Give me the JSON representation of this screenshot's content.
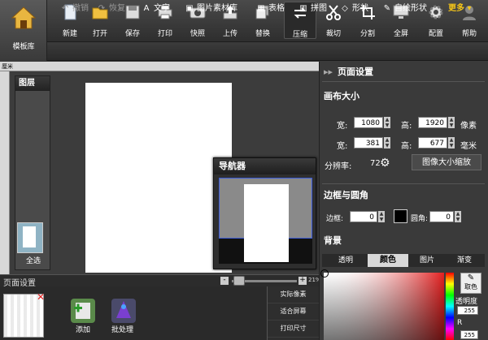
{
  "toolbar": {
    "logo_label": "模板库",
    "buttons": [
      {
        "label": "新建",
        "icon": "new-file-icon"
      },
      {
        "label": "打开",
        "icon": "folder-open-icon"
      },
      {
        "label": "保存",
        "icon": "save-disk-icon"
      },
      {
        "label": "打印",
        "icon": "printer-icon"
      },
      {
        "label": "快照",
        "icon": "camera-icon"
      },
      {
        "label": "上传",
        "icon": "upload-tray-icon"
      },
      {
        "label": "替换",
        "icon": "replace-stack-icon"
      },
      {
        "label": "压缩",
        "icon": "compress-arrows-icon"
      },
      {
        "label": "裁切",
        "icon": "scissors-icon"
      },
      {
        "label": "分割",
        "icon": "crop-icon"
      },
      {
        "label": "全屏",
        "icon": "monitor-icon"
      },
      {
        "label": "配置",
        "icon": "gear-icon"
      },
      {
        "label": "帮助",
        "icon": "help-person-icon"
      }
    ]
  },
  "toolbar2": {
    "undo": "撤销",
    "redo": "恢复",
    "text": "文字",
    "image_lib": "图片素材库",
    "table": "表格",
    "collage": "拼图",
    "shape": "形状",
    "custom_shape": "自绘形状",
    "more": "更多"
  },
  "ruler_unit": "厘米",
  "layers": {
    "title": "图层",
    "select_all": "全选"
  },
  "navigator": {
    "title": "导航器"
  },
  "zoom": {
    "section_title": "页面设置",
    "minus": "-",
    "plus": "+",
    "percent": "21%",
    "level": 0.21
  },
  "bottom": {
    "add": "添加",
    "batch": "批处理",
    "menu": [
      "实际像素",
      "适合屏幕",
      "打印尺寸"
    ]
  },
  "right_panel": {
    "title": "页面设置",
    "canvas_size_title": "画布大小",
    "width_label": "宽:",
    "height_label": "高:",
    "width_px": "1080",
    "height_px": "1920",
    "unit_px": "像素",
    "width_mm": "381",
    "height_mm": "677",
    "unit_mm": "毫米",
    "resolution_label": "分辨率:",
    "resolution": "72",
    "resize_button": "图像大小缩放",
    "border_title": "边框与圆角",
    "border_label": "边框:",
    "border_value": "0",
    "corner_label": "圆角:",
    "corner_value": "0",
    "background_title": "背景",
    "tabs": [
      "透明",
      "颜色",
      "图片",
      "渐变"
    ],
    "active_tab": "颜色",
    "picker_label": "取色",
    "opacity_label": "透明度",
    "r_label": "R",
    "opacity_value": "255",
    "r_value": "255"
  },
  "colors": {
    "accent_more": "#f5c518",
    "selected_color": "#e32020"
  }
}
